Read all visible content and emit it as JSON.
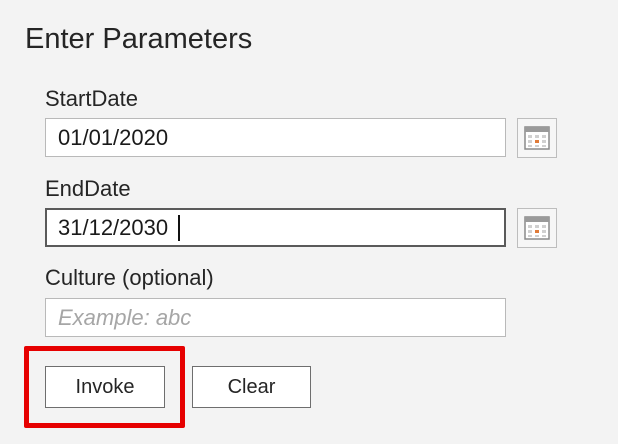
{
  "dialog": {
    "title": "Enter Parameters"
  },
  "fields": {
    "start_date": {
      "label": "StartDate",
      "value": "01/01/2020",
      "icon": "calendar-icon"
    },
    "end_date": {
      "label": "EndDate",
      "value": "31/12/2030",
      "icon": "calendar-icon"
    },
    "culture": {
      "label": "Culture (optional)",
      "value": "",
      "placeholder": "Example: abc"
    }
  },
  "buttons": {
    "invoke": "Invoke",
    "clear": "Clear"
  },
  "colors": {
    "highlight": "#e60000",
    "calendar_accent": "#e07b39"
  }
}
